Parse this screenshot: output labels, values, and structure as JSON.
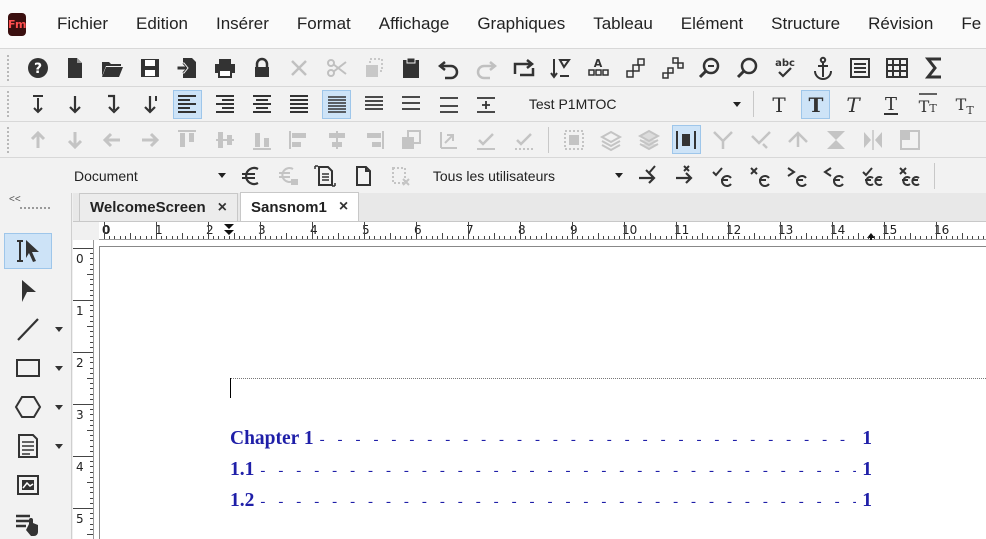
{
  "app": {
    "logo_text": "Fm",
    "menu": [
      "Fichier",
      "Edition",
      "Insérer",
      "Format",
      "Affichage",
      "Graphiques",
      "Tableau",
      "Elément",
      "Structure",
      "Révision",
      "Fe"
    ]
  },
  "toolbar2": {
    "font_dropdown_value": "Test P1MTOC"
  },
  "toolbar4": {
    "document_dropdown_value": "Document",
    "users_dropdown_value": "Tous les utilisateurs"
  },
  "palette": {
    "collapse_label": "<<"
  },
  "tabs": [
    {
      "label": "WelcomeScreen",
      "active": false
    },
    {
      "label": "Sansnom1",
      "active": true
    }
  ],
  "ruler": {
    "h_labels": [
      "0",
      "1",
      "2",
      "3",
      "4",
      "5",
      "6",
      "7",
      "8",
      "9",
      "10",
      "11",
      "12",
      "13",
      "14",
      "15",
      "16"
    ],
    "v_labels": [
      "0",
      "1",
      "2",
      "3",
      "4",
      "5"
    ]
  },
  "document": {
    "toc": [
      {
        "label": "Chapter 1",
        "page": "1"
      },
      {
        "label": "1.1",
        "page": "1"
      },
      {
        "label": "1.2",
        "page": "1"
      }
    ]
  },
  "colors": {
    "toc_text": "#1f1fa8",
    "active_tool": "#cde3f7",
    "logo_bg": "#3a0f0f",
    "logo_fg": "#ff4f4f"
  }
}
